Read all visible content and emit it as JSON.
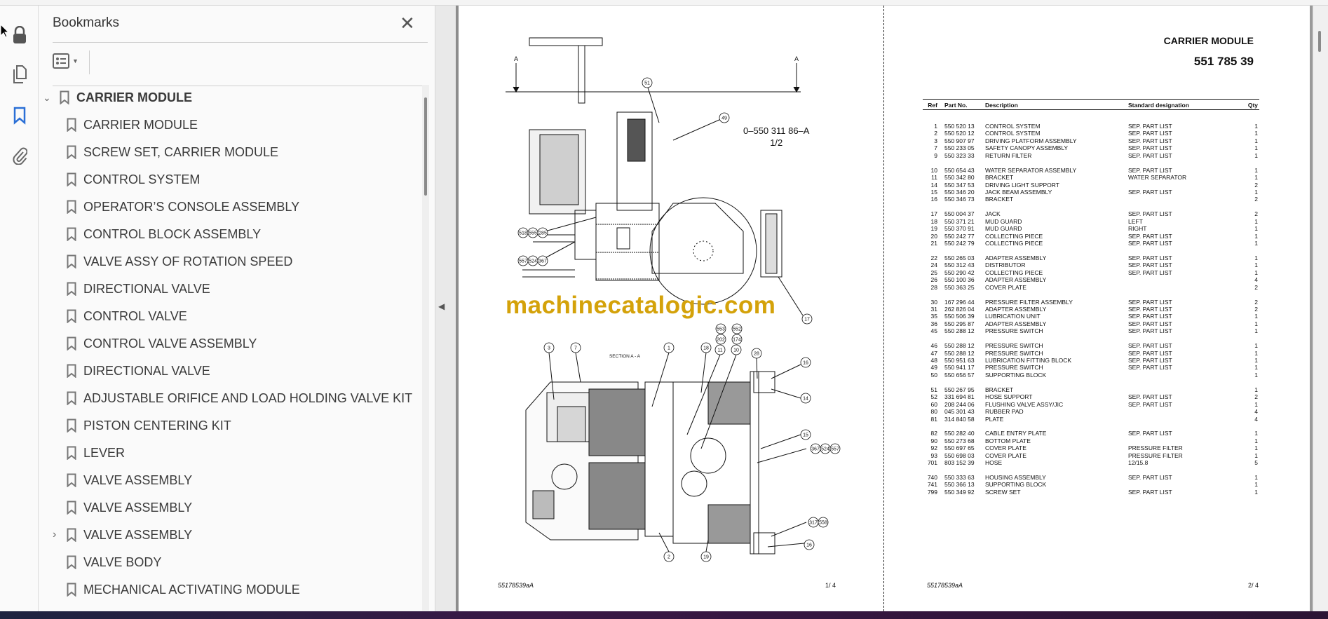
{
  "sidebar": {
    "title": "Bookmarks",
    "close_icon": "close-icon",
    "items": [
      {
        "label": "CARRIER MODULE",
        "level": 0,
        "expanded": true
      },
      {
        "label": "CARRIER MODULE"
      },
      {
        "label": "SCREW SET, CARRIER MODULE"
      },
      {
        "label": "CONTROL SYSTEM"
      },
      {
        "label": "OPERATOR’S CONSOLE ASSEMBLY"
      },
      {
        "label": "CONTROL BLOCK ASSEMBLY"
      },
      {
        "label": "VALVE ASSY OF ROTATION SPEED"
      },
      {
        "label": "DIRECTIONAL VALVE"
      },
      {
        "label": "CONTROL VALVE"
      },
      {
        "label": "CONTROL VALVE ASSEMBLY"
      },
      {
        "label": "DIRECTIONAL VALVE"
      },
      {
        "label": "ADJUSTABLE ORIFICE AND LOAD HOLDING VALVE KIT"
      },
      {
        "label": "PISTON CENTERING KIT"
      },
      {
        "label": "LEVER"
      },
      {
        "label": "VALVE ASSEMBLY"
      },
      {
        "label": "VALVE ASSEMBLY"
      },
      {
        "label": "VALVE ASSEMBLY",
        "collapsed_children": true
      },
      {
        "label": "VALVE BODY"
      },
      {
        "label": "MECHANICAL ACTIVATING MODULE"
      }
    ]
  },
  "rail_icons": [
    "lock-icon",
    "copy-pages-icon",
    "bookmark-icon",
    "paperclip-icon"
  ],
  "colors": {
    "accent": "#2a6fd6",
    "watermark": "#d4a20a"
  },
  "page1": {
    "drawing_number": "0–550 311 86–A",
    "sheet": "1/2",
    "section_label": "SECTION  A - A",
    "section_marker": "A",
    "callouts": [
      "51",
      "49",
      "518",
      "555",
      "285",
      "557",
      "524",
      "367",
      "17",
      "3",
      "7",
      "1",
      "18",
      "553",
      "552",
      "202",
      "174",
      "11",
      "10",
      "28",
      "16",
      "14",
      "15",
      "367",
      "524",
      "557",
      "317",
      "558",
      "16",
      "2",
      "19"
    ],
    "watermark": "machinecatalogic.com",
    "footer_code": "55178539aA",
    "page_label": "1/  4"
  },
  "page2": {
    "title": "CARRIER MODULE",
    "number": "551 785 39",
    "columns": [
      "Ref",
      "Part No.",
      "Description",
      "Standard designation",
      "Qty"
    ],
    "groups": [
      [
        [
          "1",
          "550 520 13",
          "CONTROL SYSTEM",
          "SEP. PART LIST",
          "1"
        ],
        [
          "2",
          "550 520 12",
          "CONTROL SYSTEM",
          "SEP. PART LIST",
          "1"
        ],
        [
          "3",
          "550 907 97",
          "DRIVING PLATFORM ASSEMBLY",
          "SEP. PART LIST",
          "1"
        ],
        [
          "7",
          "550 233 05",
          "SAFETY CANOPY ASSEMBLY",
          "SEP. PART LIST",
          "1"
        ],
        [
          "9",
          "550 323 33",
          "RETURN FILTER",
          "SEP. PART LIST",
          "1"
        ]
      ],
      [
        [
          "10",
          "550 654 43",
          "WATER SEPARATOR ASSEMBLY",
          "SEP. PART LIST",
          "1"
        ],
        [
          "11",
          "550 342 80",
          "BRACKET",
          "WATER SEPARATOR",
          "1"
        ],
        [
          "14",
          "550 347 53",
          "DRIVING LIGHT SUPPORT",
          "",
          "2"
        ],
        [
          "15",
          "550 346 20",
          "JACK BEAM ASSEMBLY",
          "SEP. PART LIST",
          "1"
        ],
        [
          "16",
          "550 346 73",
          "BRACKET",
          "",
          "2"
        ]
      ],
      [
        [
          "17",
          "550 004 37",
          "JACK",
          "SEP. PART LIST",
          "2"
        ],
        [
          "18",
          "550 371 21",
          "MUD GUARD",
          "LEFT",
          "1"
        ],
        [
          "19",
          "550 370 91",
          "MUD GUARD",
          "RIGHT",
          "1"
        ],
        [
          "20",
          "550 242 77",
          "COLLECTING PIECE",
          "SEP. PART LIST",
          "1"
        ],
        [
          "21",
          "550 242 79",
          "COLLECTING PIECE",
          "SEP. PART LIST",
          "1"
        ]
      ],
      [
        [
          "22",
          "550 265 03",
          "ADAPTER ASSEMBLY",
          "SEP. PART LIST",
          "1"
        ],
        [
          "24",
          "550 312 43",
          "DISTRIBUTOR",
          "SEP. PART LIST",
          "1"
        ],
        [
          "25",
          "550 290 42",
          "COLLECTING PIECE",
          "SEP. PART LIST",
          "1"
        ],
        [
          "26",
          "550 100 36",
          "ADAPTER ASSEMBLY",
          "",
          "4"
        ],
        [
          "28",
          "550 363 25",
          "COVER PLATE",
          "",
          "2"
        ]
      ],
      [
        [
          "30",
          "167 296 44",
          "PRESSURE FILTER ASSEMBLY",
          "SEP. PART LIST",
          "2"
        ],
        [
          "31",
          "262 826 04",
          "ADAPTER ASSEMBLY",
          "SEP. PART LIST",
          "2"
        ],
        [
          "35",
          "550 506 39",
          "LUBRICATION UNIT",
          "SEP. PART LIST",
          "1"
        ],
        [
          "36",
          "550 295 87",
          "ADAPTER ASSEMBLY",
          "SEP. PART LIST",
          "1"
        ],
        [
          "45",
          "550 288 12",
          "PRESSURE SWITCH",
          "SEP. PART LIST",
          "1"
        ]
      ],
      [
        [
          "46",
          "550 288 12",
          "PRESSURE SWITCH",
          "SEP. PART LIST",
          "1"
        ],
        [
          "47",
          "550 288 12",
          "PRESSURE SWITCH",
          "SEP. PART LIST",
          "1"
        ],
        [
          "48",
          "550 951 63",
          "LUBRICATION FITTING BLOCK",
          "SEP. PART LIST",
          "1"
        ],
        [
          "49",
          "550 941 17",
          "PRESSURE SWITCH",
          "SEP. PART LIST",
          "1"
        ],
        [
          "50",
          "550 656 57",
          "SUPPORTING BLOCK",
          "",
          "1"
        ]
      ],
      [
        [
          "51",
          "550 267 95",
          "BRACKET",
          "",
          "1"
        ],
        [
          "52",
          "331 694 81",
          "HOSE SUPPORT",
          "SEP. PART LIST",
          "2"
        ],
        [
          "60",
          "208 244 06",
          "FLUSHING VALVE ASSY/JIC",
          "SEP. PART LIST",
          "1"
        ],
        [
          "80",
          "045 301 43",
          "RUBBER PAD",
          "",
          "4"
        ],
        [
          "81",
          "314 840 58",
          "PLATE",
          "",
          "4"
        ]
      ],
      [
        [
          "82",
          "550 282 40",
          "CABLE ENTRY PLATE",
          "SEP. PART LIST",
          "1"
        ],
        [
          "90",
          "550 273 68",
          "BOTTOM PLATE",
          "",
          "1"
        ],
        [
          "92",
          "550 697 65",
          "COVER PLATE",
          "PRESSURE FILTER",
          "1"
        ],
        [
          "93",
          "550 698 03",
          "COVER PLATE",
          "PRESSURE FILTER",
          "1"
        ],
        [
          "701",
          "803 152 39",
          "HOSE",
          "12/15.8",
          "5"
        ]
      ],
      [
        [
          "740",
          "550 333 63",
          "HOUSING ASSEMBLY",
          "SEP. PART LIST",
          "1"
        ],
        [
          "741",
          "550 366 13",
          "SUPPORTING BLOCK",
          "",
          "1"
        ],
        [
          "799",
          "550 349 92",
          "SCREW SET",
          "SEP. PART LIST",
          "1"
        ]
      ]
    ],
    "footer_code": "55178539aA",
    "page_label": "2/  4"
  }
}
